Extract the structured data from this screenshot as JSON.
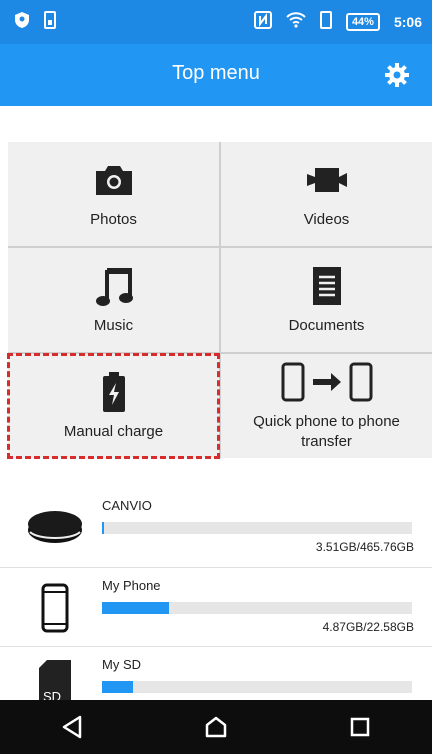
{
  "status_bar": {
    "battery_percent": "44%",
    "time": "5:06",
    "icons": [
      "shield-icon",
      "sim-icon",
      "nfc-icon",
      "wifi-icon",
      "battery-icon"
    ]
  },
  "app_bar": {
    "title": "Top menu",
    "settings_icon": "gear-icon"
  },
  "menu": {
    "tiles": [
      {
        "label": "Photos",
        "icon": "camera-icon"
      },
      {
        "label": "Videos",
        "icon": "video-camera-icon"
      },
      {
        "label": "Music",
        "icon": "music-note-icon"
      },
      {
        "label": "Documents",
        "icon": "document-icon"
      },
      {
        "label": "Manual charge",
        "icon": "battery-charge-icon",
        "highlighted": true
      },
      {
        "label": "Quick phone to phone transfer",
        "icon": "phone-transfer-icon"
      }
    ],
    "highlight_color": "#d62c2c"
  },
  "storage": [
    {
      "name": "CANVIO",
      "capacity": "3.51GB/465.76GB",
      "used_fraction": 0.0075,
      "icon": "external-drive-icon"
    },
    {
      "name": "My Phone",
      "capacity": "4.87GB/22.58GB",
      "used_fraction": 0.216,
      "icon": "phone-icon"
    },
    {
      "name": "My SD",
      "used_fraction": 0.1,
      "icon": "sd-card-icon",
      "icon_label": "SD"
    }
  ],
  "colors": {
    "accent": "#2196f3",
    "status_bar": "#1e88e5",
    "nav_bar": "#0d0d0d"
  },
  "nav_bar": {
    "buttons": [
      "back-icon",
      "home-icon",
      "recents-icon"
    ]
  }
}
